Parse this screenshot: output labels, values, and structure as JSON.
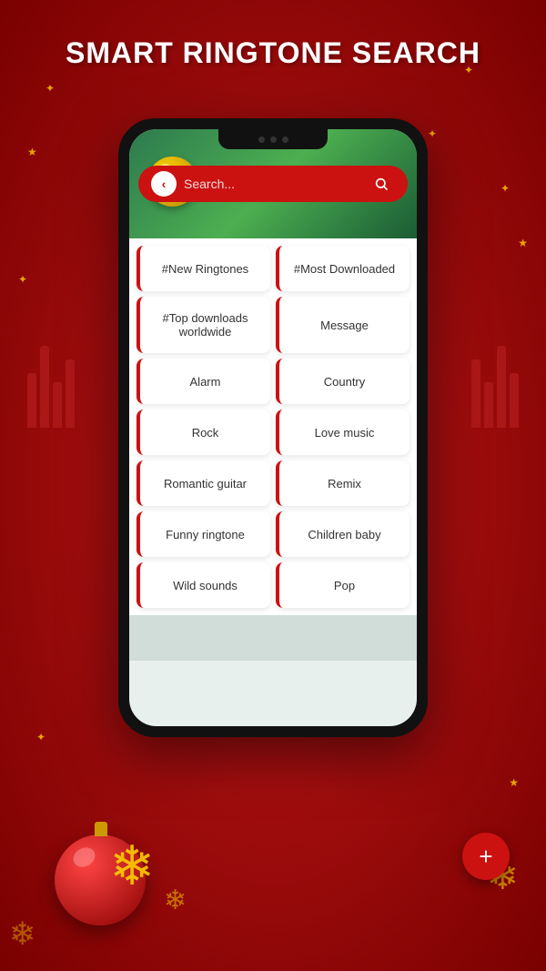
{
  "page": {
    "title": "SMART RINGTONE SEARCH",
    "background_color": "#c0181a"
  },
  "search": {
    "placeholder": "Search...",
    "back_icon": "‹",
    "search_icon": "🔍"
  },
  "categories": [
    {
      "id": 0,
      "label": "#New Ringtones"
    },
    {
      "id": 1,
      "label": "#Most Downloaded"
    },
    {
      "id": 2,
      "label": "#Top downloads worldwide"
    },
    {
      "id": 3,
      "label": "Message"
    },
    {
      "id": 4,
      "label": "Alarm"
    },
    {
      "id": 5,
      "label": "Country"
    },
    {
      "id": 6,
      "label": "Rock"
    },
    {
      "id": 7,
      "label": "Love music"
    },
    {
      "id": 8,
      "label": "Romantic guitar"
    },
    {
      "id": 9,
      "label": "Remix"
    },
    {
      "id": 10,
      "label": "Funny ringtone"
    },
    {
      "id": 11,
      "label": "Children baby"
    },
    {
      "id": 12,
      "label": "Wild sounds"
    },
    {
      "id": 13,
      "label": "Pop"
    }
  ],
  "fab": {
    "label": "+"
  }
}
